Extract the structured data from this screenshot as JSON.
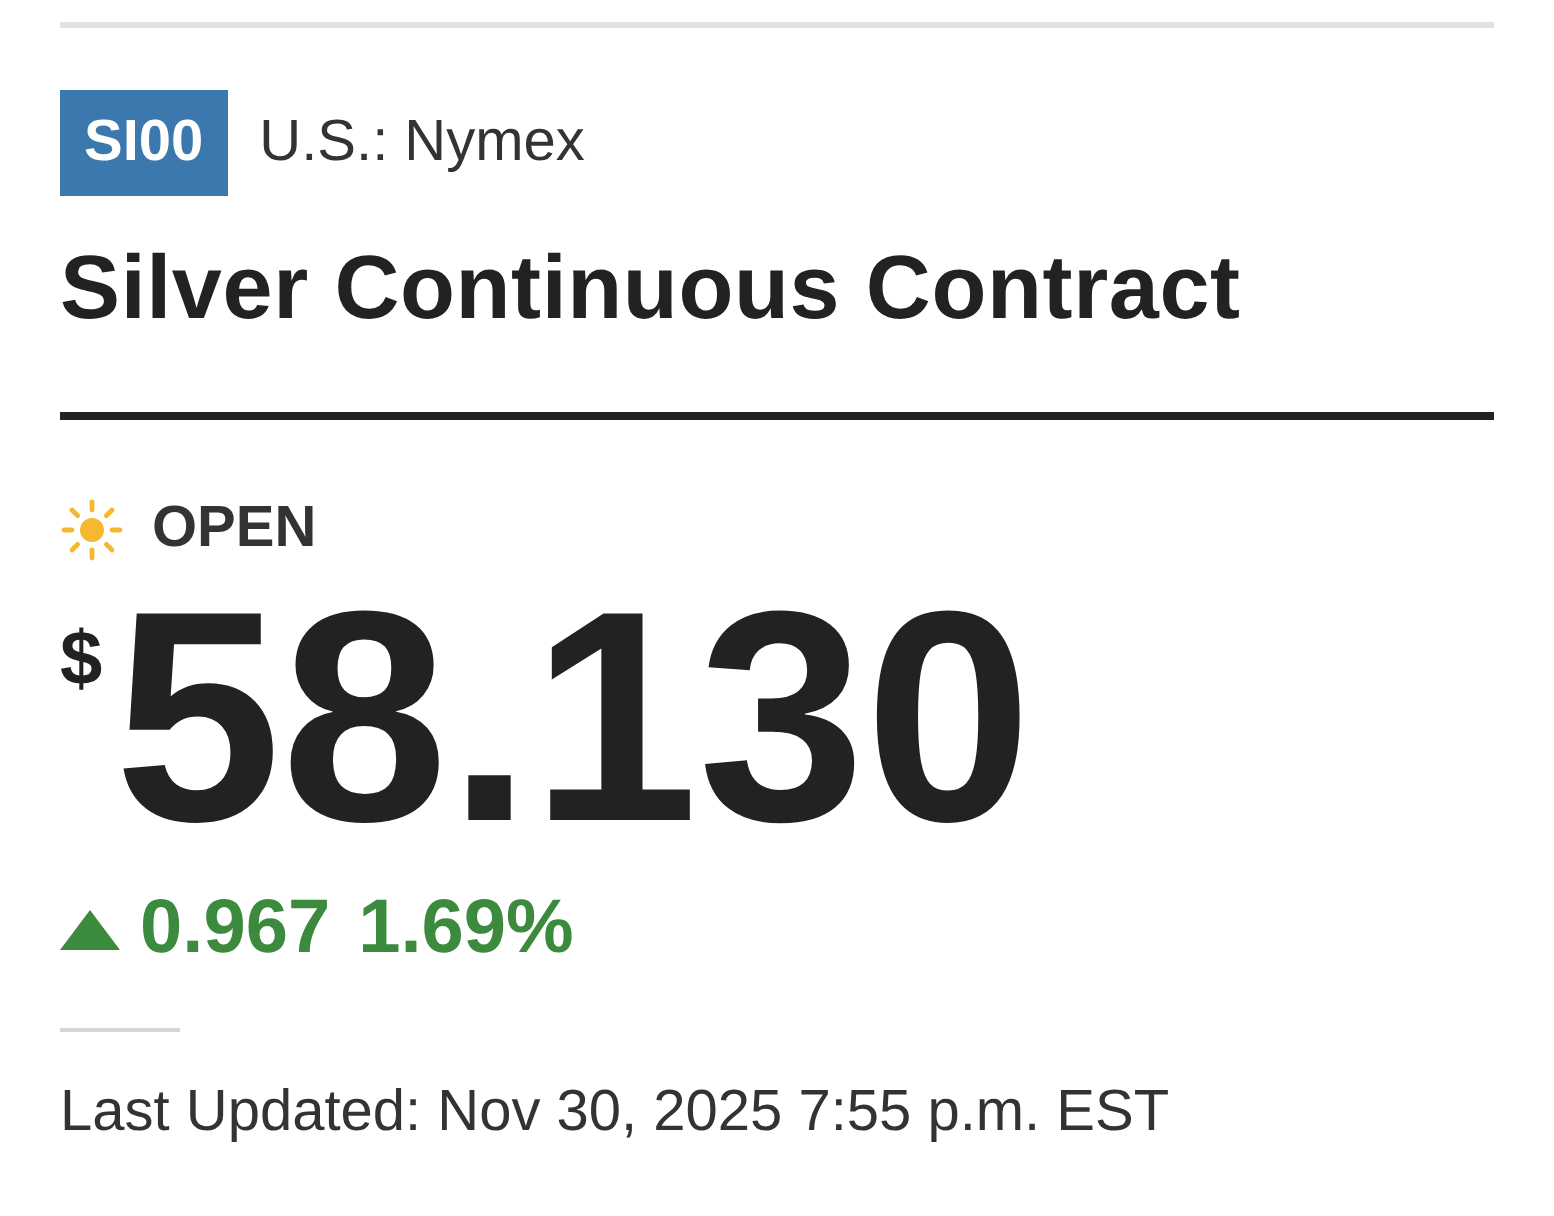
{
  "symbol": "SI00",
  "exchange": "U.S.: Nymex",
  "title": "Silver Continuous Contract",
  "market_status": {
    "label": "OPEN",
    "open": true
  },
  "price": {
    "currency": "$",
    "value": "58.130"
  },
  "change": {
    "up": true,
    "amount": "0.967",
    "percent": "1.69%"
  },
  "last_updated": "Last Updated: Nov 30, 2025 7:55 p.m. EST"
}
